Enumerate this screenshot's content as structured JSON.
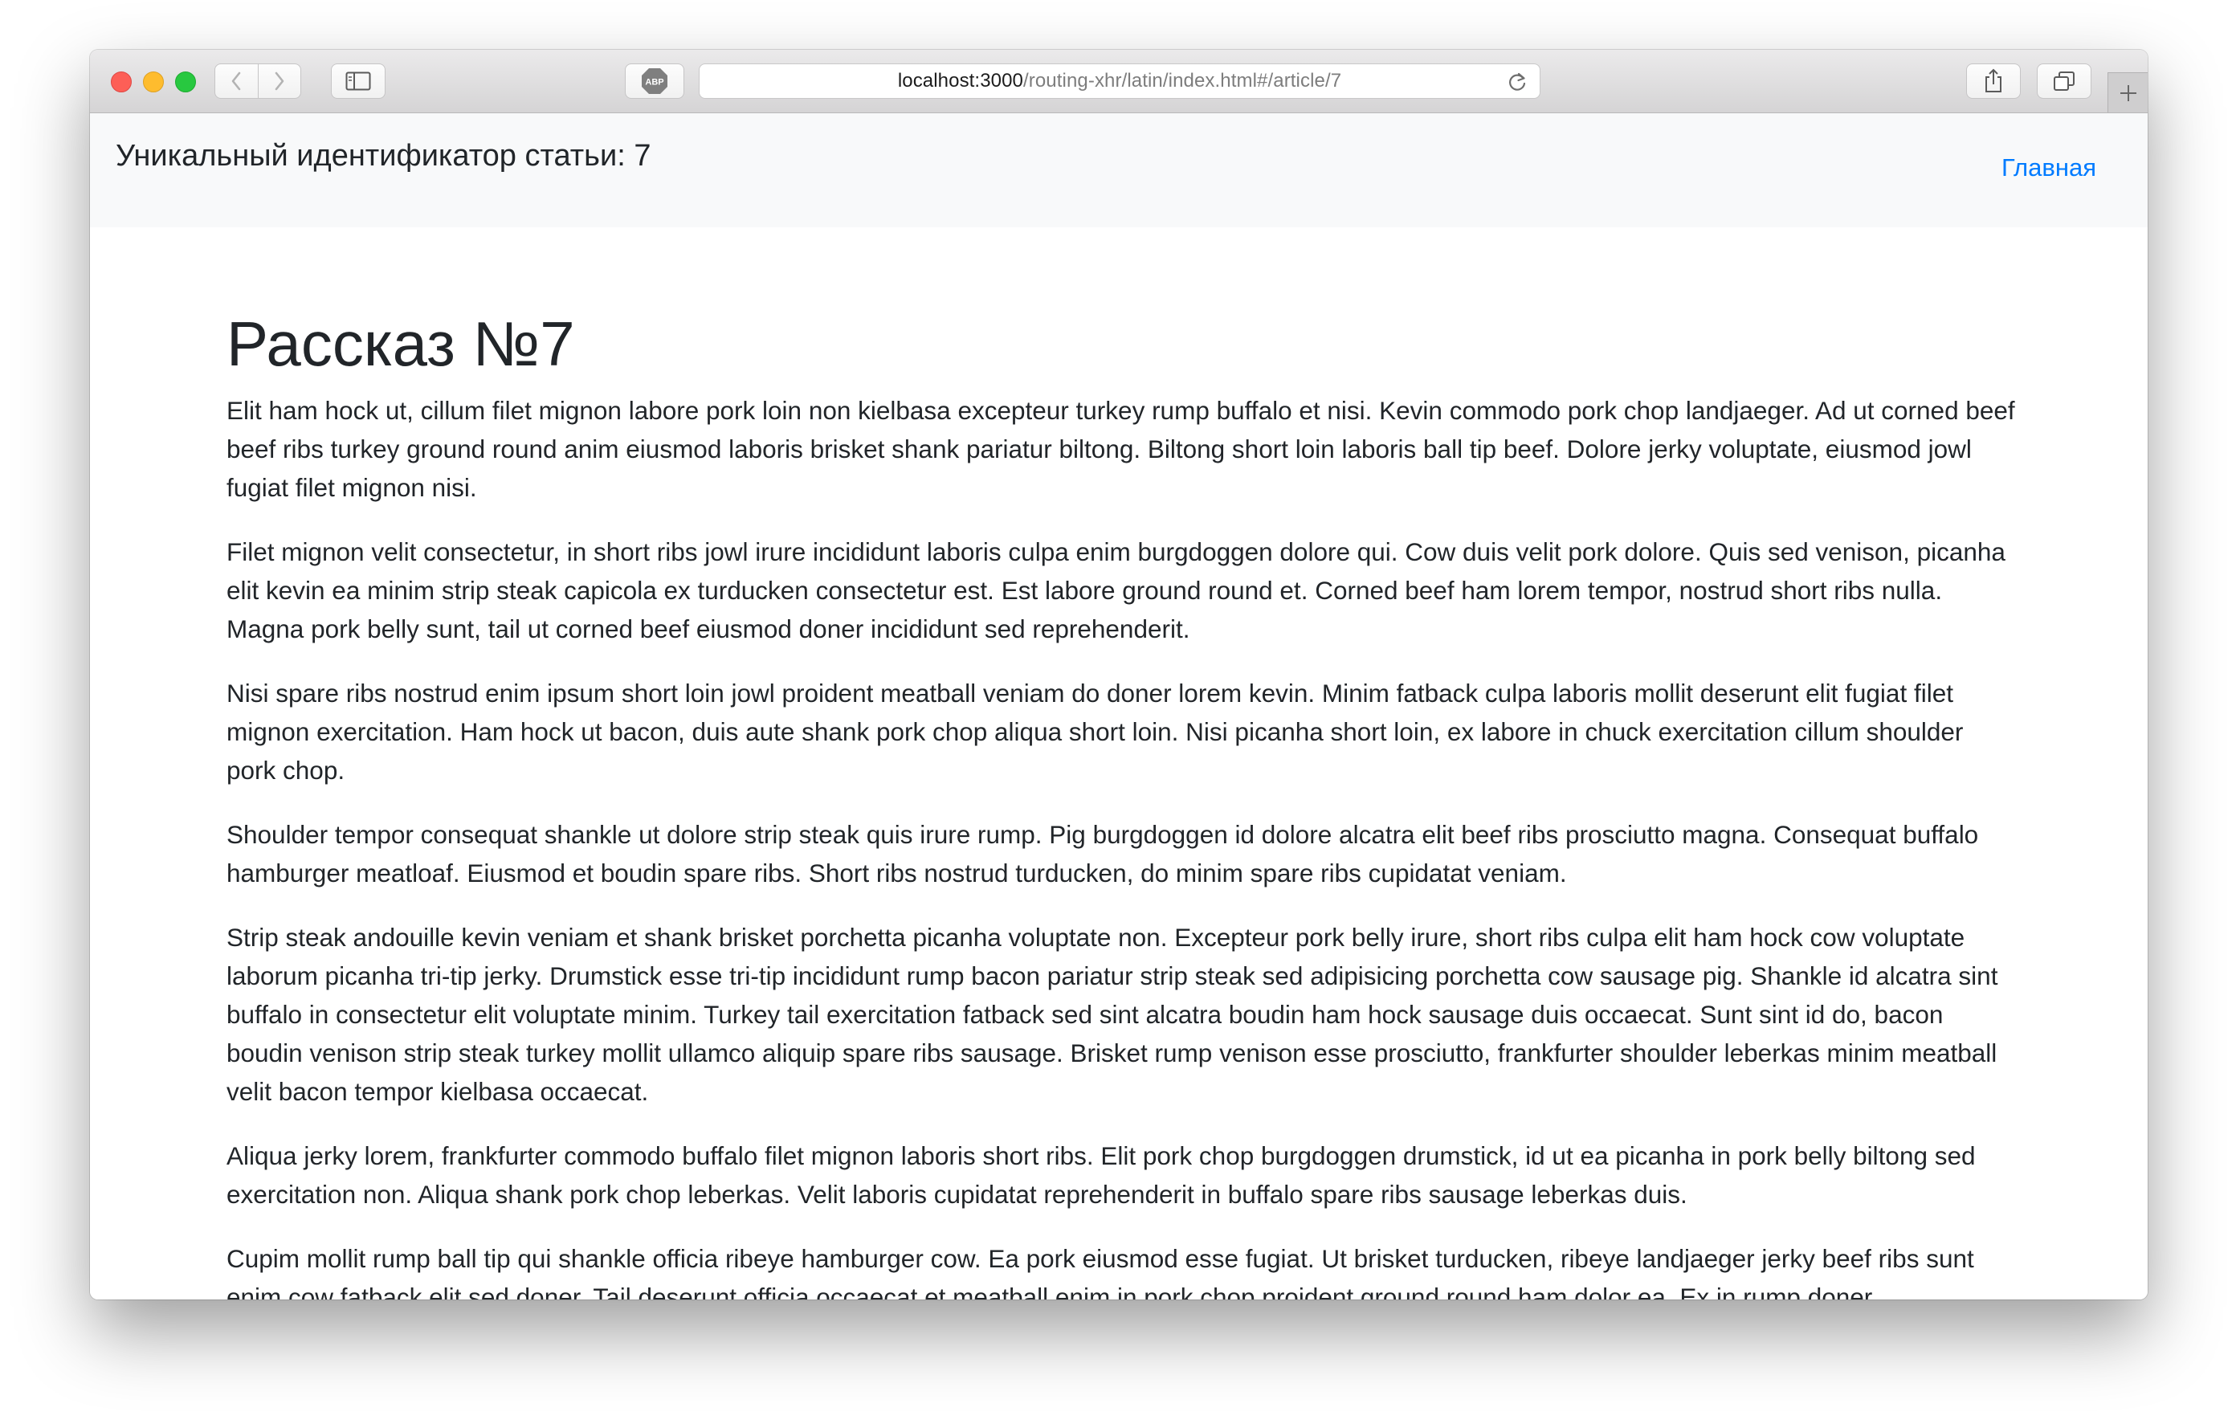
{
  "browser": {
    "url_host": "localhost:3000",
    "url_path": "/routing-xhr/latin/index.html#/article/7",
    "icons": {
      "back": "chevron-left-icon",
      "forward": "chevron-right-icon",
      "sidebar": "sidebar-icon",
      "adblock": "abp-icon",
      "reload": "reload-icon",
      "share": "share-icon",
      "tabs": "tabs-overview-icon",
      "new_tab": "plus-icon"
    },
    "abp_label": "ABP"
  },
  "navbar": {
    "brand": "Уникальный идентификатор статьи: 7",
    "home_link": "Главная",
    "link_color": "#007bff"
  },
  "article": {
    "title": "Рассказ №7",
    "paragraphs": [
      "Elit ham hock ut, cillum filet mignon labore pork loin non kielbasa excepteur turkey rump buffalo et nisi. Kevin commodo pork chop landjaeger. Ad ut corned beef beef ribs turkey ground round anim eiusmod laboris brisket shank pariatur biltong. Biltong short loin laboris ball tip beef. Dolore jerky voluptate, eiusmod jowl fugiat filet mignon nisi.",
      "Filet mignon velit consectetur, in short ribs jowl irure incididunt laboris culpa enim burgdoggen dolore qui. Cow duis velit pork dolore. Quis sed venison, picanha elit kevin ea minim strip steak capicola ex turducken consectetur est. Est labore ground round et. Corned beef ham lorem tempor, nostrud short ribs nulla. Magna pork belly sunt, tail ut corned beef eiusmod doner incididunt sed reprehenderit.",
      "Nisi spare ribs nostrud enim ipsum short loin jowl proident meatball veniam do doner lorem kevin. Minim fatback culpa laboris mollit deserunt elit fugiat filet mignon exercitation. Ham hock ut bacon, duis aute shank pork chop aliqua short loin. Nisi picanha short loin, ex labore in chuck exercitation cillum shoulder pork chop.",
      "Shoulder tempor consequat shankle ut dolore strip steak quis irure rump. Pig burgdoggen id dolore alcatra elit beef ribs prosciutto magna. Consequat buffalo hamburger meatloaf. Eiusmod et boudin spare ribs. Short ribs nostrud turducken, do minim spare ribs cupidatat veniam.",
      "Strip steak andouille kevin veniam et shank brisket porchetta picanha voluptate non. Excepteur pork belly irure, short ribs culpa elit ham hock cow voluptate laborum picanha tri-tip jerky. Drumstick esse tri-tip incididunt rump bacon pariatur strip steak sed adipisicing porchetta cow sausage pig. Shankle id alcatra sint buffalo in consectetur elit voluptate minim. Turkey tail exercitation fatback sed sint alcatra boudin ham hock sausage duis occaecat. Sunt sint id do, bacon boudin venison strip steak turkey mollit ullamco aliquip spare ribs sausage. Brisket rump venison esse prosciutto, frankfurter shoulder leberkas minim meatball velit bacon tempor kielbasa occaecat.",
      "Aliqua jerky lorem, frankfurter commodo buffalo filet mignon laboris short ribs. Elit pork chop burgdoggen drumstick, id ut ea picanha in pork belly biltong sed exercitation non. Aliqua shank pork chop leberkas. Velit laboris cupidatat reprehenderit in buffalo spare ribs sausage leberkas duis.",
      "Cupim mollit rump ball tip qui shankle officia ribeye hamburger cow. Ea pork eiusmod esse fugiat. Ut brisket turducken, ribeye landjaeger jerky beef ribs sunt enim cow fatback elit sed doner. Tail deserunt officia occaecat et meatball enim in pork chop proident ground round ham dolor ea. Ex in rump doner"
    ]
  }
}
